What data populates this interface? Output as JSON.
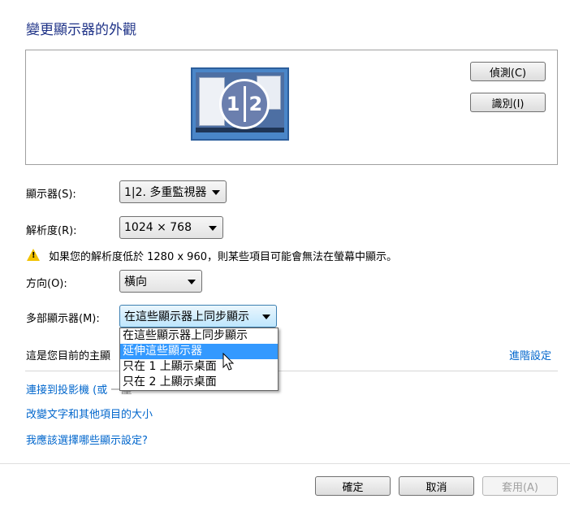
{
  "title": "變更顯示器的外觀",
  "preview": {
    "badge_left": "1",
    "badge_right": "2",
    "detect_button": "偵測(C)",
    "identify_button": "識別(I)"
  },
  "settings": {
    "display_label": "顯示器(S):",
    "display_value": "1|2. 多重監視器",
    "resolution_label": "解析度(R):",
    "resolution_value": "1024 × 768",
    "warning_text": "如果您的解析度低於 1280 x 960，則某些項目可能會無法在螢幕中顯示。",
    "orientation_label": "方向(O):",
    "orientation_value": "橫向",
    "multi_label": "多部顯示器(M):",
    "multi_value": "在這些顯示器上同步顯示"
  },
  "dropdown_options": [
    {
      "label": "在這些顯示器上同步顯示",
      "selected": false
    },
    {
      "label": "延伸這些顯示器",
      "selected": true
    },
    {
      "label": "只在 1 上顯示桌面",
      "selected": false
    },
    {
      "label": "只在 2 上顯示桌面",
      "selected": false
    }
  ],
  "main_display_text": "這是您目前的主顯",
  "advanced_link": "進階設定",
  "links": {
    "projector": "連接到投影機 (或",
    "projector_tail": "一塵",
    "text_size": "改變文字和其他項目的大小",
    "which_settings": "我應該選擇哪些顯示設定?"
  },
  "buttons": {
    "ok": "確定",
    "cancel": "取消",
    "apply": "套用(A)"
  },
  "colors": {
    "title": "#1e3287",
    "link": "#0066cc",
    "selection": "#3399ff"
  }
}
